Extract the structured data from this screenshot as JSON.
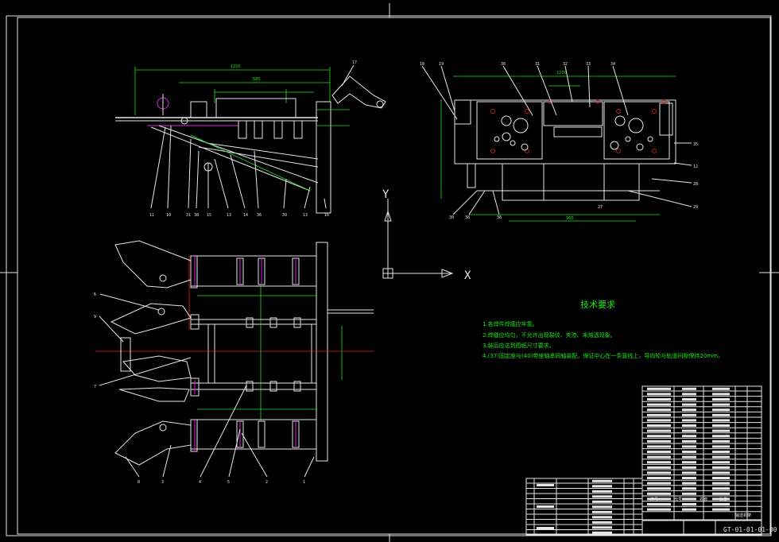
{
  "tech_requirements": {
    "title": "技术要求",
    "items": [
      "1.各焊件焊接应牢靠。",
      "2.焊缝应均匀，不允许出现裂纹、夹渣、未熔透现象。",
      "3.装后应达到图纸尺寸要求。",
      "4.(37)固定座与(40)带座轴承同轴装配，保证中心在一条直线上，导向轮与轨道间隙保持20mm。"
    ]
  },
  "axis_labels": {
    "y": "Y",
    "x": "X"
  },
  "drawing_number": "GT-01-01-01-00",
  "title_block": {
    "col_headers": [
      "序号",
      "代号",
      "名称",
      "数量"
    ],
    "drawing_name": "输送机架"
  },
  "part_balloons_top_left": [
    "11",
    "10",
    "31",
    "38",
    "15",
    "13",
    "14",
    "36",
    "39",
    "13",
    "16",
    "17"
  ],
  "part_balloons_top_right": [
    "18",
    "19",
    "30",
    "31",
    "32",
    "33",
    "34",
    "35",
    "12",
    "28",
    "29",
    "27",
    "30",
    "38",
    "38"
  ],
  "part_balloons_bottom": [
    "6",
    "9",
    "7",
    "8",
    "3",
    "4",
    "5",
    "2",
    "1"
  ],
  "dims": {
    "top_left_overall": "1200",
    "top_left_inner": "680",
    "top_right_overall": "1200",
    "top_right_bottom": "960"
  },
  "colors": {
    "background": "#000000",
    "object_lines": "#e6e6e6",
    "dimensions": "#19e619",
    "centerlines": "#e62020",
    "highlight": "#e61de6",
    "callouts": "#e6e600"
  }
}
